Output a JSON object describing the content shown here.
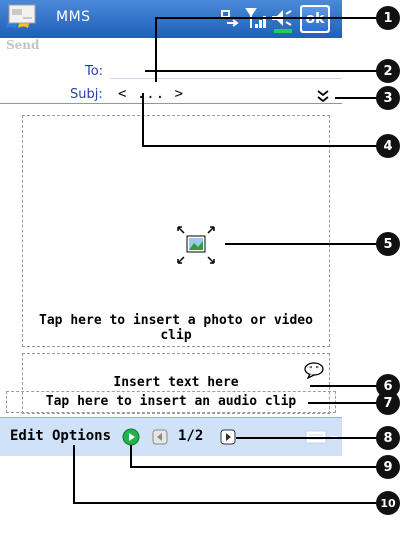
{
  "title_bar": {
    "app_title": "MMS",
    "ok_label": "ok",
    "icons": [
      "windows-start-icon",
      "connectivity-icon",
      "signal-icon",
      "volume-icon"
    ]
  },
  "header": {
    "send_label": "Send",
    "to_label": "To:",
    "to_value": "",
    "subj_label": "Subj:",
    "subj_value": "< ... >",
    "expand_icon": "double-chevron-down-icon"
  },
  "content": {
    "photo_placeholder": "Tap here to insert a photo or video clip",
    "text_placeholder": "Insert text here",
    "audio_placeholder": "Tap here to insert an audio clip"
  },
  "menu_bar": {
    "edit_label": "Edit",
    "options_label": "Options",
    "slide_counter": "1/2",
    "play_icon": "play-icon",
    "prev_icon": "previous-slide-icon",
    "next_icon": "next-slide-icon",
    "keyboard_icon": "keyboard-icon"
  },
  "callouts": [
    "1",
    "2",
    "3",
    "4",
    "5",
    "6",
    "7",
    "8",
    "9",
    "10"
  ],
  "colors": {
    "title_bar": "#1f5fb8",
    "menu_bar": "#cfe2f8",
    "label_blue": "#2a3fa8",
    "play_green": "#22b14c"
  }
}
